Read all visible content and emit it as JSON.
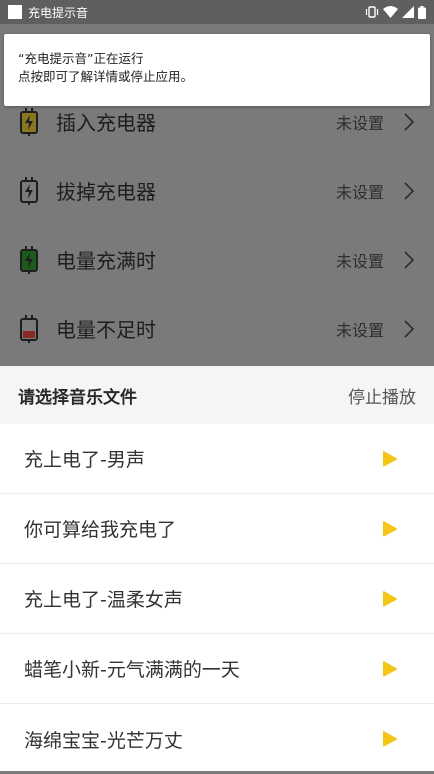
{
  "status_bar": {
    "title": "充电提示音",
    "icons": [
      "vibrate-icon",
      "wifi-icon",
      "signal-icon",
      "battery-icon"
    ]
  },
  "notification": {
    "line1": "“充电提示音”正在运行",
    "line2": "点按即可了解详情或停止应用。"
  },
  "settings": {
    "items": [
      {
        "label": "插入充电器",
        "value": "未设置",
        "icon": "battery-charging-icon"
      },
      {
        "label": "拔掉充电器",
        "value": "未设置",
        "icon": "battery-unplugged-icon"
      },
      {
        "label": "电量充满时",
        "value": "未设置",
        "icon": "battery-full-icon"
      },
      {
        "label": "电量不足时",
        "value": "未设置",
        "icon": "battery-low-icon"
      }
    ]
  },
  "sheet": {
    "title": "请选择音乐文件",
    "stop_label": "停止播放",
    "items": [
      {
        "name": "充上电了-男声"
      },
      {
        "name": "你可算给我充电了"
      },
      {
        "name": "充上电了-温柔女声"
      },
      {
        "name": "蜡笔小新-元气满满的一天"
      },
      {
        "name": "海绵宝宝-光芒万丈"
      }
    ]
  },
  "colors": {
    "accent": "#f5c518",
    "overlay": "#7a7a7a",
    "battery_yellow": "#f2c21b",
    "battery_green": "#2a9d2a",
    "battery_red": "#c0392b"
  }
}
